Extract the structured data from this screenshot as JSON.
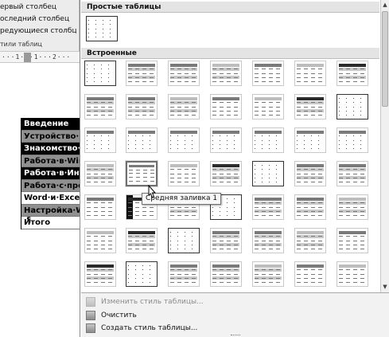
{
  "ribbon": {
    "options": [
      "ервый столбец",
      "оследний столбец",
      "редующиеся столбцы"
    ],
    "group_caption": "тили таблиц"
  },
  "ruler": {
    "text": "···1···1···2···"
  },
  "document": {
    "table_rows": [
      {
        "text": "Введение",
        "shade": "dark"
      },
      {
        "text": "Устройство·к",
        "shade": "grey"
      },
      {
        "text": "Знакомство·с",
        "shade": "dark"
      },
      {
        "text": "Работа·в·Winc",
        "shade": "grey"
      },
      {
        "text": "Работа·в·Инте",
        "shade": "dark"
      },
      {
        "text": "Работа·с·прог",
        "shade": "grey"
      },
      {
        "text": "Word·и·Excel·",
        "shade": "light"
      },
      {
        "text": "Настройка·Win",
        "shade": "grey"
      },
      {
        "text": "Итого",
        "shade": "light"
      }
    ],
    "pilcrow": "¶"
  },
  "gallery": {
    "section_simple": "Простые таблицы",
    "section_builtin": "Встроенные",
    "selected_style": "Средняя заливка 1",
    "scroll_up_glyph": "▲",
    "scroll_down_glyph": "▼"
  },
  "menu": {
    "items": [
      {
        "label": "Изменить стиль таблицы...",
        "enabled": false,
        "icon": "table-style-edit-icon"
      },
      {
        "label": "Очистить",
        "enabled": true,
        "icon": "clear-table-icon"
      },
      {
        "label": "Создать стиль таблицы...",
        "enabled": true,
        "icon": "new-table-style-icon"
      }
    ]
  },
  "colors": {
    "header_band": "#e4e4e4",
    "dark_fill": "#2b2b2b",
    "mid_fill": "#7a7a7a",
    "light_fill": "#bdbdbd"
  }
}
